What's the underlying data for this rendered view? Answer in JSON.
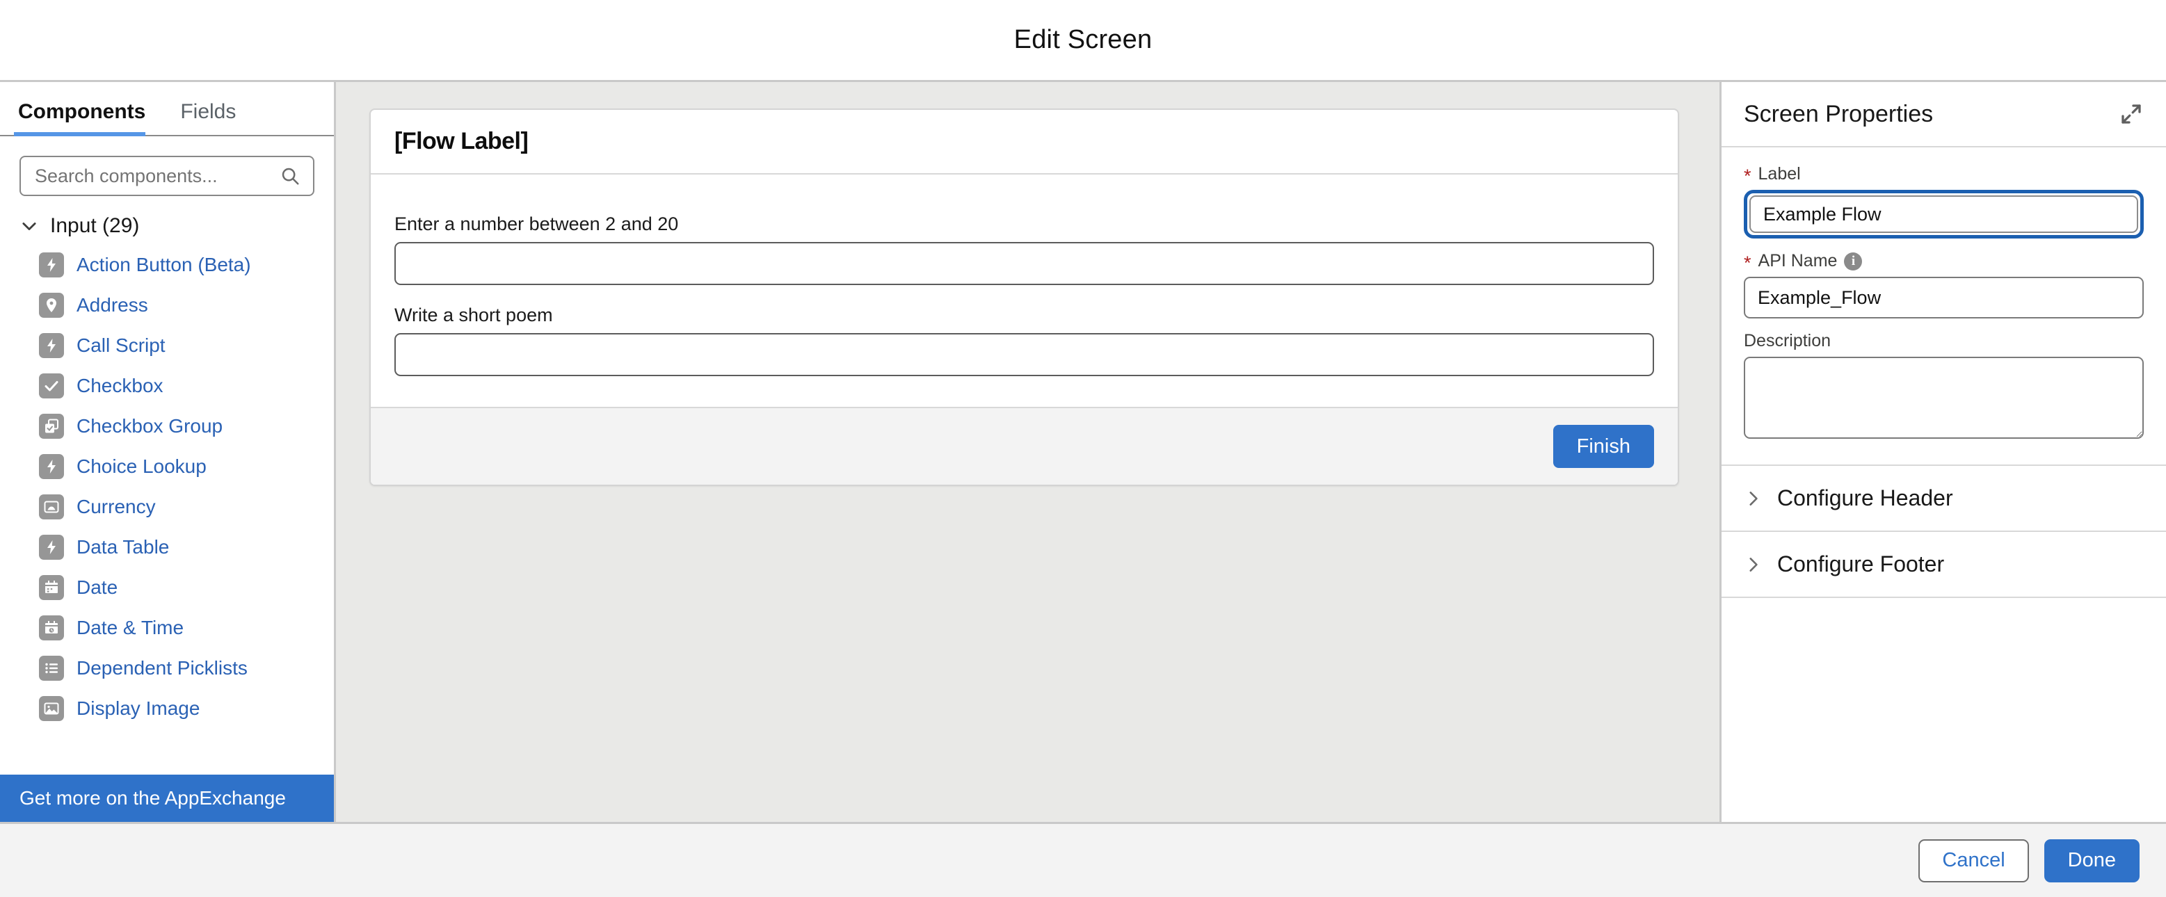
{
  "header": {
    "title": "Edit Screen"
  },
  "left_panel": {
    "tabs": [
      {
        "label": "Components",
        "active": true
      },
      {
        "label": "Fields",
        "active": false
      }
    ],
    "search": {
      "placeholder": "Search components...",
      "value": "",
      "icon": "search-icon"
    },
    "section": {
      "label": "Input (29)",
      "expanded": true,
      "icon": "chevron-down-icon"
    },
    "components": [
      {
        "label": "Action Button (Beta)",
        "icon": "lightning-icon"
      },
      {
        "label": "Address",
        "icon": "location-pin-icon"
      },
      {
        "label": "Call Script",
        "icon": "lightning-icon"
      },
      {
        "label": "Checkbox",
        "icon": "check-icon"
      },
      {
        "label": "Checkbox Group",
        "icon": "checkbox-group-icon"
      },
      {
        "label": "Choice Lookup",
        "icon": "lightning-icon"
      },
      {
        "label": "Currency",
        "icon": "currency-icon"
      },
      {
        "label": "Data Table",
        "icon": "lightning-icon"
      },
      {
        "label": "Date",
        "icon": "calendar-icon"
      },
      {
        "label": "Date & Time",
        "icon": "calendar-clock-icon"
      },
      {
        "label": "Dependent Picklists",
        "icon": "list-icon"
      },
      {
        "label": "Display Image",
        "icon": "image-icon"
      }
    ],
    "appexchange_label": "Get more on the AppExchange"
  },
  "canvas": {
    "card_title": "[Flow Label]",
    "fields": [
      {
        "label": "Enter a number between 2 and 20",
        "value": "",
        "placeholder": ""
      },
      {
        "label": "Write a short poem",
        "value": "",
        "placeholder": ""
      }
    ],
    "finish_label": "Finish"
  },
  "right_panel": {
    "title": "Screen Properties",
    "expand_icon": "expand-diagonal-icon",
    "label_field": {
      "label": "Label",
      "required": true,
      "value": "Example Flow",
      "focused": true
    },
    "api_name_field": {
      "label": "API Name",
      "required": true,
      "value": "Example_Flow",
      "info_icon": "info-icon",
      "info_glyph": "i"
    },
    "description_field": {
      "label": "Description",
      "required": false,
      "value": ""
    },
    "accordions": [
      {
        "label": "Configure Header",
        "expanded": false,
        "icon": "chevron-right-icon"
      },
      {
        "label": "Configure Footer",
        "expanded": false,
        "icon": "chevron-right-icon"
      }
    ]
  },
  "footer": {
    "cancel_label": "Cancel",
    "done_label": "Done"
  },
  "colors": {
    "brand_blue": "#2f72c9",
    "link_blue": "#2a61b4",
    "focus_ring": "#1b5fb0",
    "required_red": "#b02020",
    "icon_gray": "#969696"
  }
}
